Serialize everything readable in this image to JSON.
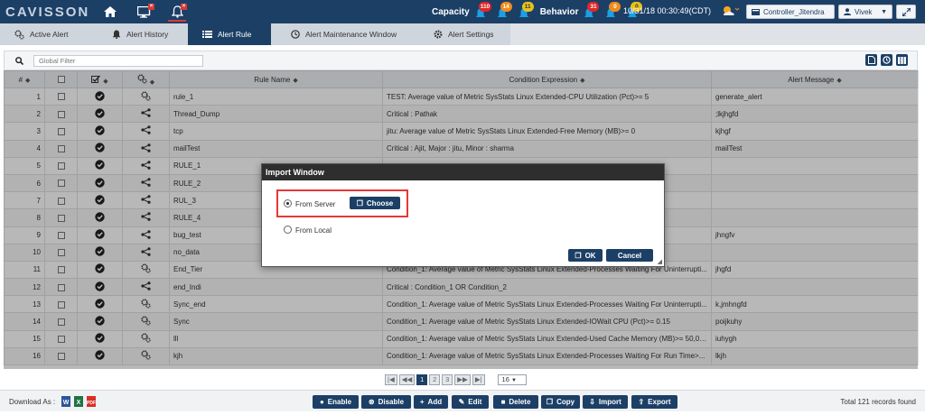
{
  "header": {
    "logo": "CAVISSON",
    "capacity_label": "Capacity",
    "capacity_counts": [
      "110",
      "14",
      "11"
    ],
    "behavior_label": "Behavior",
    "behavior_counts": [
      "31",
      "0",
      "0"
    ],
    "datetime": "10/31/18 00:30:49(CDT)",
    "controller_label": "Controller_Jitendra",
    "user_label": "Vivek"
  },
  "tabs": [
    {
      "label": "Active Alert",
      "icon": "gears-icon"
    },
    {
      "label": "Alert History",
      "icon": "bell-icon"
    },
    {
      "label": "Alert Rule",
      "icon": "list-icon"
    },
    {
      "label": "Alert Maintenance Window",
      "icon": "clock-icon"
    },
    {
      "label": "Alert Settings",
      "icon": "gear-icon"
    }
  ],
  "filter": {
    "placeholder": "Global Filter"
  },
  "table": {
    "columns": {
      "num": "#",
      "rule_name": "Rule Name",
      "condition": "Condition Expression",
      "message": "Alert Message"
    },
    "rows": [
      {
        "n": "1",
        "type": "gears",
        "name": "rule_1",
        "cond": "TEST: Average value of Metric SysStats Linux Extended-CPU Utilization (Pct)>= 5",
        "msg": "generate_alert"
      },
      {
        "n": "2",
        "type": "share",
        "name": "Thread_Dump",
        "cond": "Critical : Pathak",
        "msg": ";lkjhgfd"
      },
      {
        "n": "3",
        "type": "share",
        "name": "tcp",
        "cond": "jitu: Average value of Metric SysStats Linux Extended-Free Memory (MB)>= 0",
        "msg": "kjhgf"
      },
      {
        "n": "4",
        "type": "share",
        "name": "mailTest",
        "cond": "Critical : Ajit, Major : jitu, Minor : sharma",
        "msg": "mailTest"
      },
      {
        "n": "5",
        "type": "share",
        "name": "RULE_1",
        "cond": "",
        "msg": ""
      },
      {
        "n": "6",
        "type": "share",
        "name": "RULE_2",
        "cond": "",
        "msg": ""
      },
      {
        "n": "7",
        "type": "share",
        "name": "RUL_3",
        "cond": "",
        "msg": ""
      },
      {
        "n": "8",
        "type": "share",
        "name": "RULE_4",
        "cond": "",
        "msg": ""
      },
      {
        "n": "9",
        "type": "share",
        "name": "bug_test",
        "cond": "",
        "msg": "jhngfv"
      },
      {
        "n": "10",
        "type": "share",
        "name": "no_data",
        "cond": "",
        "msg": ""
      },
      {
        "n": "11",
        "type": "gears",
        "name": "End_Tier",
        "cond": "Condition_1: Average value of Metric SysStats Linux Extended-Processes Waiting For Uninterrupti...",
        "msg": "jhgfd"
      },
      {
        "n": "12",
        "type": "share",
        "name": "end_Indi",
        "cond": "Critical : Condition_1 OR Condition_2",
        "msg": ""
      },
      {
        "n": "13",
        "type": "gears",
        "name": "Sync_end",
        "cond": "Condition_1: Average value of Metric SysStats Linux Extended-Processes Waiting For Uninterrupti...",
        "msg": "k,jmhngfd"
      },
      {
        "n": "14",
        "type": "gears",
        "name": "Sync",
        "cond": "Condition_1: Average value of Metric SysStats Linux Extended-IOWait CPU (Pct)>= 0.15",
        "msg": "poijkuhy"
      },
      {
        "n": "15",
        "type": "gears",
        "name": "lll",
        "cond": "Condition_1: Average value of Metric SysStats Linux Extended-Used Cache Memory (MB)>= 50,000",
        "msg": "iuhygh"
      },
      {
        "n": "16",
        "type": "gears",
        "name": "kjh",
        "cond": "Condition_1: Average value of Metric SysStats Linux Extended-Processes Waiting For Run Time>...",
        "msg": "lkjh"
      }
    ]
  },
  "pagination": {
    "pages": [
      "1",
      "2",
      "3"
    ],
    "current": "1",
    "page_size": "16"
  },
  "footer": {
    "download_label": "Download As :",
    "buttons": [
      "Enable",
      "Disable",
      "Add",
      "Edit",
      "Delete",
      "Copy",
      "Import",
      "Export"
    ],
    "total": "Total 121 records found"
  },
  "modal": {
    "title": "Import Window",
    "from_server": "From Server",
    "choose": "Choose",
    "from_local": "From Local",
    "ok": "OK",
    "cancel": "Cancel"
  },
  "colors": {
    "navy": "#1c3f66",
    "alert_red": "#e02727",
    "highlight": "#e53935"
  }
}
